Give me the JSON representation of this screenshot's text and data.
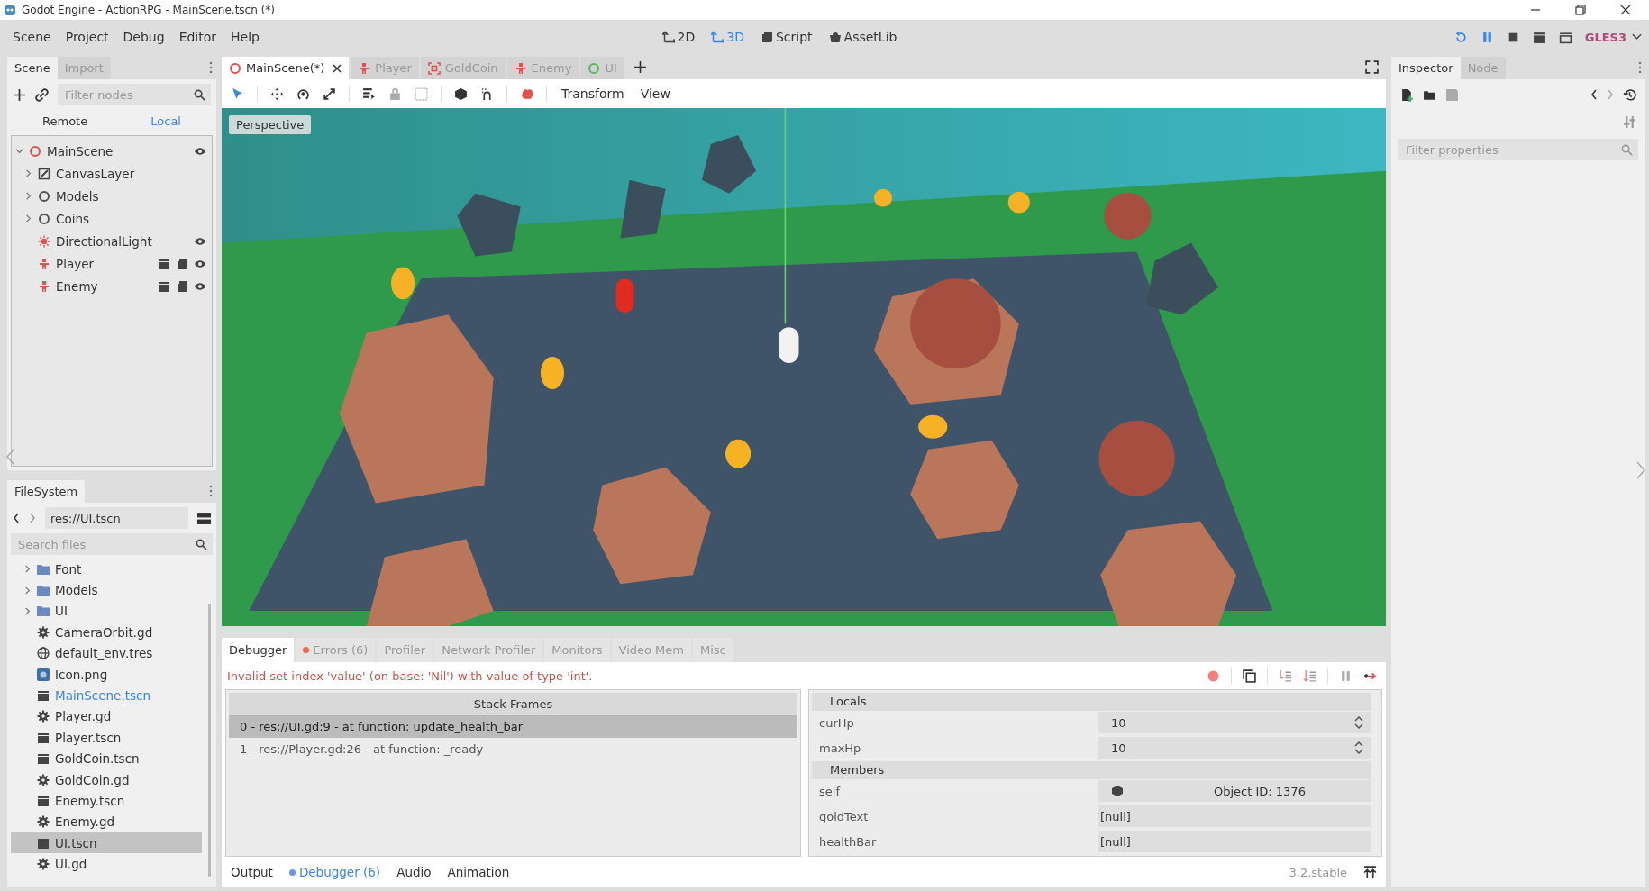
{
  "window": {
    "title": "Godot Engine - ActionRPG - MainScene.tscn (*)"
  },
  "menu": [
    "Scene",
    "Project",
    "Debug",
    "Editor",
    "Help"
  ],
  "workspaces": [
    {
      "label": "2D",
      "kind": "planar",
      "selected": false
    },
    {
      "label": "3D",
      "kind": "spatial",
      "selected": true
    },
    {
      "label": "Script",
      "kind": "script",
      "selected": false
    },
    {
      "label": "AssetLib",
      "kind": "assetlib",
      "selected": false
    }
  ],
  "renderer": "GLES3",
  "scene_dock": {
    "tabs": [
      {
        "label": "Scene",
        "selected": true
      },
      {
        "label": "Import",
        "selected": false
      }
    ],
    "filter_placeholder": "Filter nodes",
    "modes": [
      {
        "label": "Remote",
        "selected": false
      },
      {
        "label": "Local",
        "selected": true
      }
    ],
    "tree": [
      {
        "name": "MainScene",
        "kind": "root",
        "expanded": true,
        "visibility_toggle": true,
        "instanced": false,
        "script": false,
        "children": [
          {
            "name": "CanvasLayer",
            "kind": "canvas",
            "expanded": false,
            "visibility_toggle": false,
            "instanced": false,
            "script": false
          },
          {
            "name": "Models",
            "kind": "spatial",
            "expanded": false,
            "visibility_toggle": false,
            "instanced": false,
            "script": false
          },
          {
            "name": "Coins",
            "kind": "spatial",
            "expanded": false,
            "visibility_toggle": false,
            "instanced": false,
            "script": false
          },
          {
            "name": "DirectionalLight",
            "kind": "light",
            "visibility_toggle": true,
            "instanced": false,
            "script": false
          },
          {
            "name": "Player",
            "kind": "body",
            "visibility_toggle": true,
            "instanced": true,
            "script": true
          },
          {
            "name": "Enemy",
            "kind": "body",
            "visibility_toggle": true,
            "instanced": true,
            "script": true
          }
        ]
      }
    ]
  },
  "filesystem": {
    "tab": "FileSystem",
    "path": "res://UI.tscn",
    "search_placeholder": "Search files",
    "items": [
      {
        "name": "Font",
        "kind": "folder",
        "selected": false,
        "current": false
      },
      {
        "name": "Models",
        "kind": "folder",
        "selected": false,
        "current": false
      },
      {
        "name": "UI",
        "kind": "folder",
        "selected": false,
        "current": false
      },
      {
        "name": "CameraOrbit.gd",
        "kind": "script",
        "selected": false,
        "current": false
      },
      {
        "name": "default_env.tres",
        "kind": "resource",
        "selected": false,
        "current": false
      },
      {
        "name": "Icon.png",
        "kind": "image",
        "selected": false,
        "current": false
      },
      {
        "name": "MainScene.tscn",
        "kind": "scene",
        "selected": false,
        "current": true
      },
      {
        "name": "Player.gd",
        "kind": "script",
        "selected": false,
        "current": false
      },
      {
        "name": "Player.tscn",
        "kind": "scene",
        "selected": false,
        "current": false
      },
      {
        "name": "GoldCoin.tscn",
        "kind": "scene",
        "selected": false,
        "current": false
      },
      {
        "name": "GoldCoin.gd",
        "kind": "script",
        "selected": false,
        "current": false
      },
      {
        "name": "Enemy.tscn",
        "kind": "scene",
        "selected": false,
        "current": false
      },
      {
        "name": "Enemy.gd",
        "kind": "script",
        "selected": false,
        "current": false
      },
      {
        "name": "UI.tscn",
        "kind": "scene",
        "selected": true,
        "current": false
      },
      {
        "name": "UI.gd",
        "kind": "script",
        "selected": false,
        "current": false
      }
    ]
  },
  "scene_tabs": [
    {
      "label": "MainScene(*)",
      "kind": "root",
      "selected": true
    },
    {
      "label": "Player",
      "kind": "body",
      "selected": false
    },
    {
      "label": "GoldCoin",
      "kind": "area",
      "selected": false
    },
    {
      "label": "Enemy",
      "kind": "body",
      "selected": false
    },
    {
      "label": "UI",
      "kind": "control",
      "selected": false
    }
  ],
  "viewport_menus": [
    "Transform",
    "View"
  ],
  "viewport_label": "Perspective",
  "debugger": {
    "tabs": [
      {
        "label": "Debugger",
        "selected": true,
        "error_dot": false
      },
      {
        "label": "Errors (6)",
        "selected": false,
        "error_dot": true
      },
      {
        "label": "Profiler",
        "selected": false,
        "error_dot": false
      },
      {
        "label": "Network Profiler",
        "selected": false,
        "error_dot": false
      },
      {
        "label": "Monitors",
        "selected": false,
        "error_dot": false
      },
      {
        "label": "Video Mem",
        "selected": false,
        "error_dot": false
      },
      {
        "label": "Misc",
        "selected": false,
        "error_dot": false
      }
    ],
    "error": "Invalid set index 'value' (on base: 'Nil') with value of type 'int'.",
    "stack_title": "Stack Frames",
    "frames": [
      {
        "text": "0 - res://UI.gd:9 - at function: update_health_bar",
        "selected": true
      },
      {
        "text": "1 - res://Player.gd:26 - at function: _ready",
        "selected": false
      }
    ],
    "sections": [
      {
        "title": "Locals",
        "vars": [
          {
            "name": "curHp",
            "kind": "number",
            "value": "10"
          },
          {
            "name": "maxHp",
            "kind": "number",
            "value": "10"
          }
        ]
      },
      {
        "title": "Members",
        "vars": [
          {
            "name": "self",
            "kind": "object",
            "value": "Object ID: 1376"
          },
          {
            "name": "goldText",
            "kind": "plain",
            "value": "[null]"
          },
          {
            "name": "healthBar",
            "kind": "plain",
            "value": "[null]"
          }
        ]
      }
    ]
  },
  "bottom_tabs": [
    {
      "label": "Output",
      "selected": false,
      "dot": false
    },
    {
      "label": "Debugger (6)",
      "selected": true,
      "dot": true
    },
    {
      "label": "Audio",
      "selected": false,
      "dot": false
    },
    {
      "label": "Animation",
      "selected": false,
      "dot": false
    }
  ],
  "version": "3.2.stable",
  "inspector": {
    "tabs": [
      {
        "label": "Inspector",
        "selected": true
      },
      {
        "label": "Node",
        "selected": false
      }
    ],
    "filter_placeholder": "Filter properties"
  }
}
